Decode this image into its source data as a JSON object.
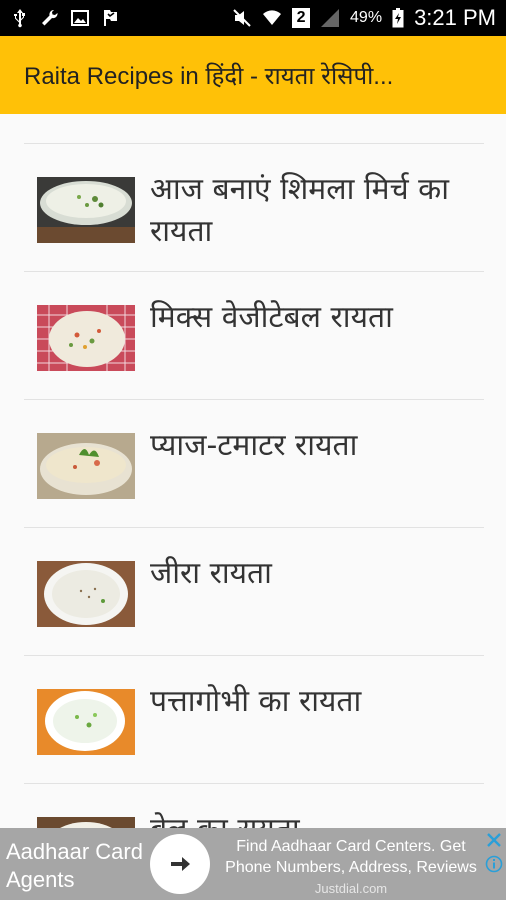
{
  "status_bar": {
    "battery_percent": "49%",
    "time": "3:21 PM",
    "sim_slot": "2",
    "icons": [
      "usb-icon",
      "wrench-icon",
      "image-icon",
      "flag-icon",
      "mute-icon",
      "wifi-icon",
      "signal-icon",
      "battery-icon"
    ]
  },
  "app_bar": {
    "title": "Raita Recipes in हिंदी - रायता रेसिपी..."
  },
  "recipes": [
    {
      "title": "आज बनाएं शिमला मिर्च का रायता"
    },
    {
      "title": "मिक्स वेजीटेबल रायता"
    },
    {
      "title": "प्याज-टमाटर रायता"
    },
    {
      "title": "जीरा रायता"
    },
    {
      "title": "पत्तागोभी का रायता"
    },
    {
      "title": "बेल का रायता"
    }
  ],
  "ad": {
    "left_text": "Aadhaar Card Agents",
    "body_text": "Find Aadhaar Card Centers. Get Phone Numbers, Address, Reviews",
    "source": "Justdial.com"
  },
  "colors": {
    "app_bar": "#ffc107",
    "ad_background": "#a6a6a6",
    "ad_icons": "#2a9fd8"
  }
}
